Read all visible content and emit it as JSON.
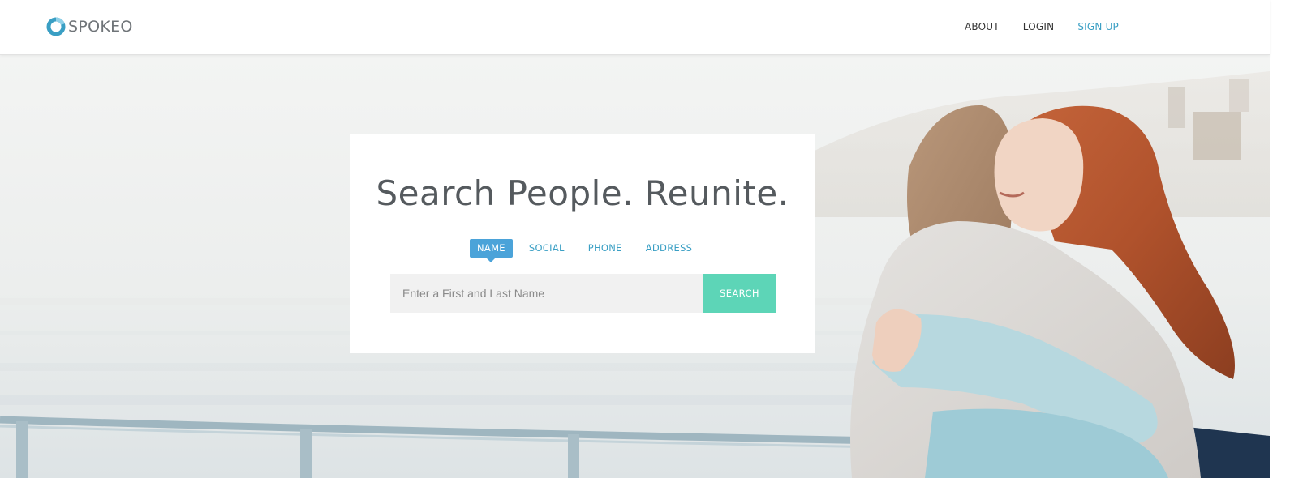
{
  "brand": {
    "name": "SPOKEO",
    "logo_icon": "spokeo-ring-logo",
    "logo_color": "#3a9fc4"
  },
  "nav": {
    "about": "ABOUT",
    "login": "LOGIN",
    "signup": "SIGN UP"
  },
  "hero": {
    "headline": "Search People. Reunite.",
    "image": "two-women-hugging-on-pier-photo"
  },
  "search": {
    "tabs": [
      {
        "label": "NAME",
        "active": true
      },
      {
        "label": "SOCIAL",
        "active": false
      },
      {
        "label": "PHONE",
        "active": false
      },
      {
        "label": "ADDRESS",
        "active": false
      }
    ],
    "input_value": "",
    "input_placeholder": "Enter a First and Last Name",
    "button_label": "SEARCH"
  },
  "colors": {
    "accent": "#3a9fc4",
    "active_tab": "#4ba3d9",
    "search_button": "#5dd5b7",
    "headline": "#555a5e"
  }
}
